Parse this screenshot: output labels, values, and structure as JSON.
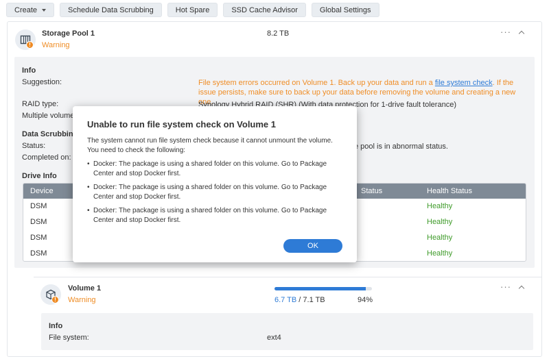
{
  "toolbar": {
    "create_label": "Create",
    "schedule_label": "Schedule Data Scrubbing",
    "hot_spare_label": "Hot Spare",
    "ssd_cache_label": "SSD Cache Advisor",
    "global_label": "Global Settings"
  },
  "pool": {
    "title": "Storage Pool 1",
    "status": "Warning",
    "capacity": "8.2 TB",
    "more": "···",
    "info": {
      "section_title": "Info",
      "suggestion_label": "Suggestion:",
      "suggestion_text_1": "File system errors occurred on Volume 1. Back up your data and run a ",
      "suggestion_link": "file system check",
      "suggestion_text_2": ". If the issue persists, make sure to back up your data before removing the volume and creating a new one.",
      "raid_label": "RAID type:",
      "raid_value": "Synology Hybrid RAID (SHR) (With data protection for 1-drive fault tolerance)",
      "multiple_label": "Multiple volume",
      "scrub_title": "Data Scrubbin",
      "status_label": "Status:",
      "status_value": "e pool is in abnormal status.",
      "completed_label": "Completed on:",
      "drive_info_title": "Drive Info",
      "table_headers": [
        "Device",
        "Status",
        "Health Status"
      ],
      "rows": [
        {
          "device": "DSM",
          "health": "Healthy"
        },
        {
          "device": "DSM",
          "health": "Healthy"
        },
        {
          "device": "DSM",
          "health": "Healthy"
        },
        {
          "device": "DSM",
          "health": "Healthy"
        }
      ]
    }
  },
  "volume": {
    "title": "Volume 1",
    "status": "Warning",
    "used": "6.7 TB",
    "separator": " / ",
    "total": "7.1 TB",
    "percent": "94%",
    "usage_fraction": 0.94,
    "more": "···",
    "info_title": "Info",
    "fs_label": "File system:",
    "fs_value": "ext4"
  },
  "dialog": {
    "title": "Unable to run file system check on Volume 1",
    "intro": "The system cannot run file system check because it cannot unmount the volume. You need to check the following:",
    "items": [
      "Docker: The package is using a shared folder on this volume. Go to Package Center and stop Docker first.",
      "Docker: The package is using a shared folder on this volume. Go to Package Center and stop Docker first.",
      "Docker: The package is using a shared folder on this volume. Go to Package Center and stop Docker first."
    ],
    "ok_label": "OK"
  },
  "colors": {
    "accent": "#2e7bd6",
    "warning": "#ef8d26",
    "healthy": "#3f9b2a",
    "table_header": "#7f8a96"
  }
}
